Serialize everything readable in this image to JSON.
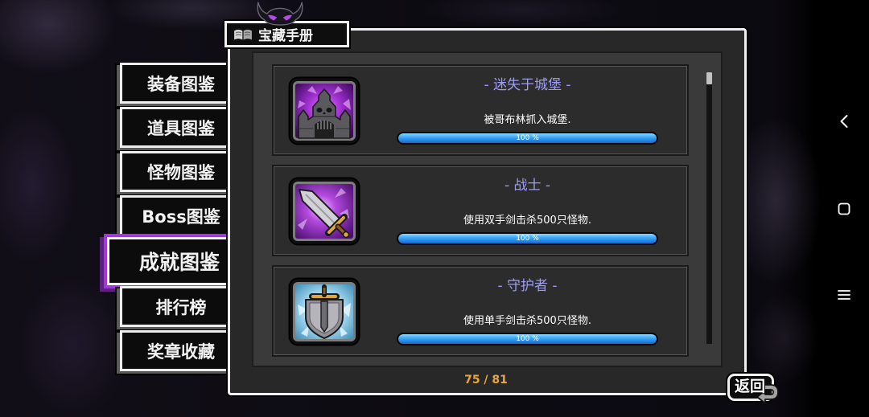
{
  "header": {
    "title": "宝藏手册",
    "icon": "book-icon"
  },
  "ornament": {
    "icon": "demon-face-icon"
  },
  "sidebar": {
    "items": [
      {
        "label": "装备图鉴",
        "selected": false
      },
      {
        "label": "道具图鉴",
        "selected": false
      },
      {
        "label": "怪物图鉴",
        "selected": false
      },
      {
        "label": "Boss图鉴",
        "selected": false
      },
      {
        "label": "成就图鉴",
        "selected": true
      },
      {
        "label": "排行榜",
        "selected": false
      },
      {
        "label": "奖章收藏",
        "selected": false
      }
    ]
  },
  "achievements": [
    {
      "icon": "castle-icon",
      "title": "- 迷失于城堡 -",
      "description": "被哥布林抓入城堡.",
      "progress": 1.0,
      "progress_label": "100 %"
    },
    {
      "icon": "sword-icon",
      "title": "- 战士 -",
      "description": "使用双手剑击杀500只怪物.",
      "progress": 1.0,
      "progress_label": "100 %"
    },
    {
      "icon": "shield-icon",
      "title": "- 守护者 -",
      "description": "使用单手剑击杀500只怪物.",
      "progress": 1.0,
      "progress_label": "100 %"
    }
  ],
  "scrollbar": {
    "position": 0
  },
  "pager": {
    "label": "75 / 81"
  },
  "back_button": {
    "label": "返回",
    "icon": "return-arrow-icon"
  },
  "system_nav": {
    "items": [
      {
        "icon": "nav-back-icon"
      },
      {
        "icon": "nav-home-icon"
      },
      {
        "icon": "nav-menu-icon"
      }
    ]
  },
  "colors": {
    "title": "#9d9cf3",
    "description": "#ffffff",
    "progress_fill": "#2f9af0",
    "pager": "#eaa63c",
    "selected_tab_border": "#a03ad6",
    "panel_bg": "#282828",
    "list_bg": "#3a3a3a",
    "tab_bg": "#0c0c0c"
  }
}
